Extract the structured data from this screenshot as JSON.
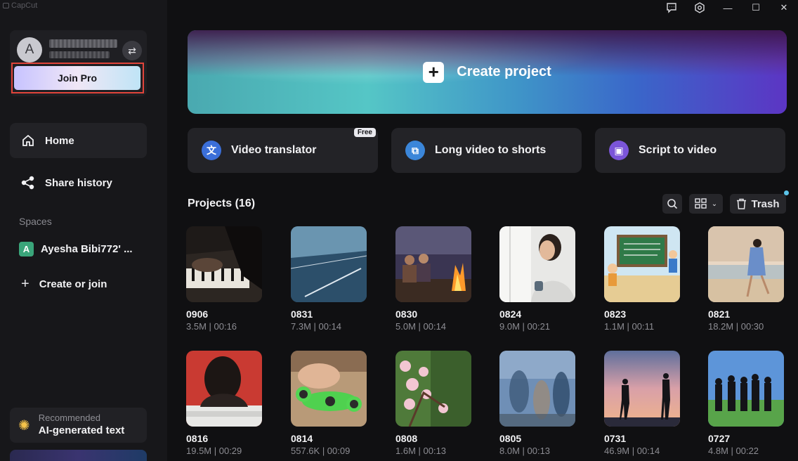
{
  "app": {
    "title": "CapCut"
  },
  "window_controls": [
    "feedback",
    "settings",
    "minimize",
    "maximize",
    "close"
  ],
  "account": {
    "avatar_letter": "A",
    "join_pro_label": "Join Pro"
  },
  "nav": {
    "home": "Home",
    "share_history": "Share history"
  },
  "spaces": {
    "label": "Spaces",
    "item_badge": "A",
    "item_name": "Ayesha Bibi772' ...",
    "create_join": "Create or join"
  },
  "recommended": {
    "small": "Recommended",
    "big": "AI-generated text"
  },
  "create_project": {
    "label": "Create project"
  },
  "features": [
    {
      "label": "Video translator",
      "badge": "Free",
      "icon": "translate-icon",
      "color": "#3b6fd9"
    },
    {
      "label": "Long video to shorts",
      "icon": "shorts-icon",
      "color": "#3b86d9"
    },
    {
      "label": "Script to video",
      "icon": "script-icon",
      "color": "#7b55d9"
    }
  ],
  "projects": {
    "title": "Projects  (16)",
    "trash_label": "Trash",
    "items": [
      {
        "name": "0906",
        "meta": "3.5M | 00:16"
      },
      {
        "name": "0831",
        "meta": "7.3M | 00:14"
      },
      {
        "name": "0830",
        "meta": "5.0M | 00:14"
      },
      {
        "name": "0824",
        "meta": "9.0M | 00:21"
      },
      {
        "name": "0823",
        "meta": "1.1M | 00:11"
      },
      {
        "name": "0821",
        "meta": "18.2M | 00:30"
      },
      {
        "name": "0816",
        "meta": "19.5M | 00:29"
      },
      {
        "name": "0814",
        "meta": "557.6K | 00:09"
      },
      {
        "name": "0808",
        "meta": "1.6M | 00:13"
      },
      {
        "name": "0805",
        "meta": "8.0M | 00:13"
      },
      {
        "name": "0731",
        "meta": "46.9M | 00:14"
      },
      {
        "name": "0727",
        "meta": "4.8M | 00:22"
      }
    ]
  }
}
